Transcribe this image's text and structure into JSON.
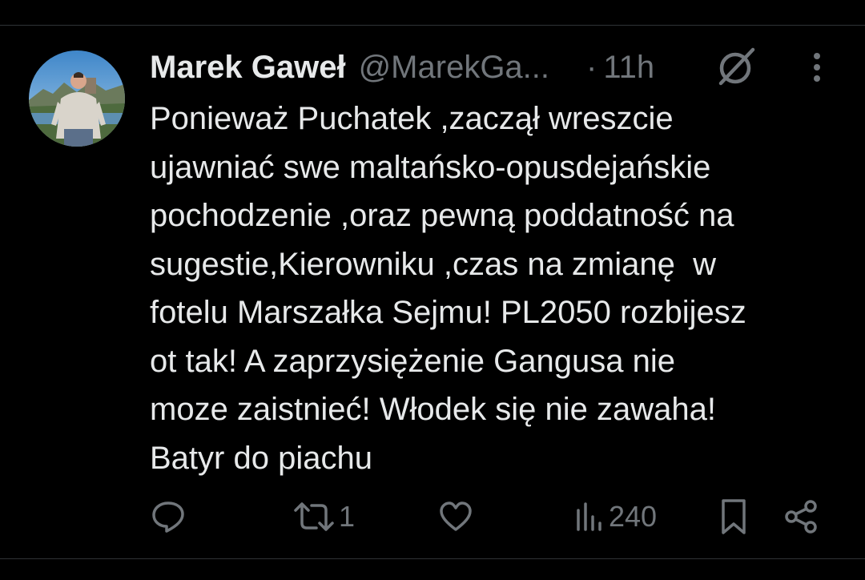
{
  "tweet": {
    "author": {
      "display_name": "Marek Gaweł",
      "handle": "@MarekGa...",
      "avatar_icon": "avatar-photo"
    },
    "separator": "·",
    "time": "11h",
    "text": "Ponieważ Puchatek ,zaczął wreszcie\nujawniać swe maltańsko-opusdejańskie\npochodzenie ,oraz pewną poddatność na\nsugestie,Kierowniku ,czas na zmianę  w\nfotelu Marszałka Sejmu! PL2050 rozbijesz\not tak! A zaprzysiężenie Gangusa nie\nmoze zaistnieć! Włodek się nie zawaha!\nBatyr do piachu",
    "actions": {
      "reply": {
        "icon": "reply-icon",
        "count": ""
      },
      "retweet": {
        "icon": "retweet-icon",
        "count": "1"
      },
      "like": {
        "icon": "heart-icon",
        "count": ""
      },
      "views": {
        "icon": "views-icon",
        "count": "240"
      },
      "bookmark": {
        "icon": "bookmark-icon"
      },
      "share": {
        "icon": "share-icon"
      }
    },
    "header_icons": [
      "grok-icon",
      "more-icon"
    ]
  },
  "colors": {
    "background": "#000000",
    "text_primary": "#e7e9ea",
    "text_secondary": "#71767b",
    "divider": "#2f3336"
  }
}
